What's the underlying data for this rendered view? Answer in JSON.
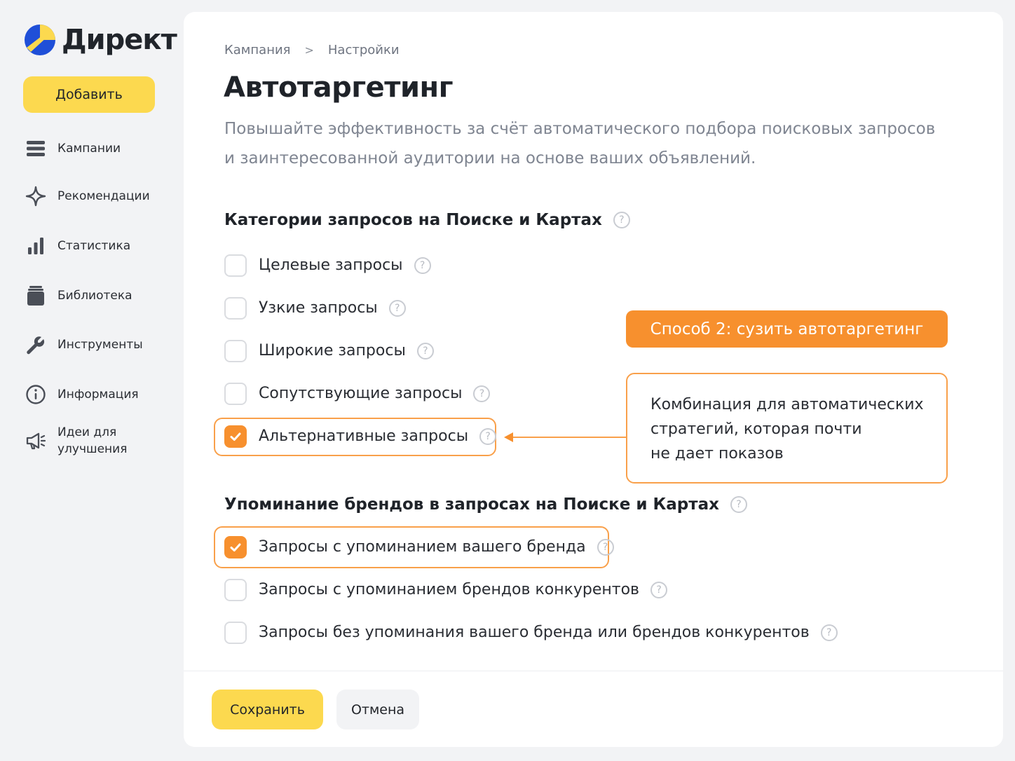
{
  "app": {
    "logo_text": "Директ",
    "add_button": "Добавить"
  },
  "sidebar": {
    "items": [
      {
        "label": "Кампании",
        "icon": "list-icon"
      },
      {
        "label": "Рекомендации",
        "icon": "sparkle-icon"
      },
      {
        "label": "Статистика",
        "icon": "bar-chart-icon"
      },
      {
        "label": "Библиотека",
        "icon": "library-icon"
      },
      {
        "label": "Инструменты",
        "icon": "wrench-icon"
      },
      {
        "label": "Информация",
        "icon": "info-icon"
      },
      {
        "label_line1": "Идеи для",
        "label_line2": "улучшения",
        "icon": "megaphone-icon"
      }
    ]
  },
  "breadcrumb": {
    "items": [
      "Кампания",
      "Настройки"
    ],
    "separator": ">"
  },
  "page": {
    "title": "Автотаргетинг",
    "description": "Повышайте эффективность за счёт автоматического подбора поисковых запросов и заинтересованной аудитории на основе ваших объявлений."
  },
  "sections": [
    {
      "title": "Категории запросов на Поиске и Картах",
      "options": [
        {
          "label": "Целевые запросы",
          "checked": false
        },
        {
          "label": "Узкие запросы",
          "checked": false
        },
        {
          "label": "Широкие запросы",
          "checked": false
        },
        {
          "label": "Сопутствующие запросы",
          "checked": false
        },
        {
          "label": "Альтернативные запросы",
          "checked": true
        }
      ]
    },
    {
      "title": "Упоминание брендов в запросах на Поиске и Картах",
      "options": [
        {
          "label": "Запросы с упоминанием вашего бренда",
          "checked": true
        },
        {
          "label": "Запросы с упоминанием брендов конкурентов",
          "checked": false
        },
        {
          "label": "Запросы без упоминания вашего бренда или брендов конкурентов",
          "checked": false
        }
      ]
    }
  ],
  "annotation": {
    "title": "Способ 2: сузить автотаргетинг",
    "note_line1": "Комбинация для автоматических",
    "note_line2": "стратегий, которая почти",
    "note_line3": "не дает показов"
  },
  "footer": {
    "save": "Сохранить",
    "cancel": "Отмена"
  },
  "help_glyph": "?",
  "colors": {
    "accent_yellow": "#fcd94f",
    "accent_orange": "#f7902e",
    "highlight_border": "#f9a04a",
    "logo_blue": "#1f4fd8"
  }
}
